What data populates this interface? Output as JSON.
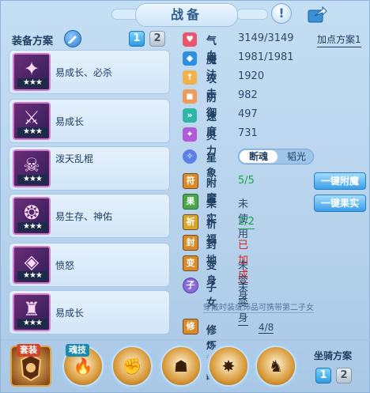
{
  "header": {
    "title": "战备",
    "help_label": "!"
  },
  "scheme": {
    "label": "装备方案",
    "buttons": [
      "1",
      "2"
    ],
    "active": "1"
  },
  "equipment": [
    {
      "name": "易成长、必杀",
      "stars": "★★★",
      "icon": "claw-weapon-icon"
    },
    {
      "name": "易成长",
      "stars": "★★★",
      "icon": "sword-icon"
    },
    {
      "name": "泼天乱棍",
      "stars": "★★★",
      "icon": "mask-icon"
    },
    {
      "name": "易生存、神佑",
      "stars": "★★★",
      "icon": "necklace-icon"
    },
    {
      "name": "愤怒",
      "stars": "★★★",
      "icon": "belt-icon"
    },
    {
      "name": "易成长",
      "stars": "★★★",
      "icon": "armor-icon"
    }
  ],
  "attributes": [
    {
      "name": "气血",
      "value": "3149/3149",
      "color": "#e8556d",
      "icon": "heart-icon"
    },
    {
      "name": "魔法",
      "value": "1981/1981",
      "color": "#2f8fe0",
      "icon": "mana-icon"
    },
    {
      "name": "攻击",
      "value": "1920",
      "color": "#f0b24a",
      "icon": "attack-icon"
    },
    {
      "name": "防御",
      "value": "982",
      "color": "#f09a5a",
      "icon": "defense-icon"
    },
    {
      "name": "速度",
      "value": "497",
      "color": "#2fb6a6",
      "icon": "speed-icon"
    },
    {
      "name": "灵力",
      "value": "731",
      "color": "#b05ad8",
      "icon": "spirit-icon"
    }
  ],
  "plus_scheme": "加点方案1",
  "star_map": {
    "label": "星象",
    "on": "断魂",
    "off": "韬光"
  },
  "rows": [
    {
      "name": "附魔",
      "value": "5/5",
      "style": "green",
      "icon": "enchant-icon"
    },
    {
      "name": "果实",
      "value": "未使用",
      "style": "normal",
      "icon": "fruit-icon"
    },
    {
      "name": "祈福",
      "value": "2/2",
      "style": "green-underline",
      "icon": "blessing-icon"
    },
    {
      "name": "封地",
      "value": "已加成",
      "style": "red",
      "icon": "fief-icon"
    },
    {
      "name": "变身",
      "value": "未变身",
      "style": "underline",
      "icon": "transform-icon"
    },
    {
      "name": "子女",
      "value": "未变身",
      "style": "underline",
      "icon": "child-icon"
    }
  ],
  "buttons": {
    "one_key_enchant": "一键附魔",
    "one_key_fruit": "一键果实"
  },
  "note": "穿戴时装或饰品可携带第二子女",
  "cultivation": {
    "name": "修炼觉醒",
    "value": "4/8"
  },
  "bottom": {
    "suit_tag": "套装",
    "soul_tag": "魂技",
    "mount_label": "坐骑方案",
    "mount_buttons": [
      "1",
      "2"
    ]
  }
}
